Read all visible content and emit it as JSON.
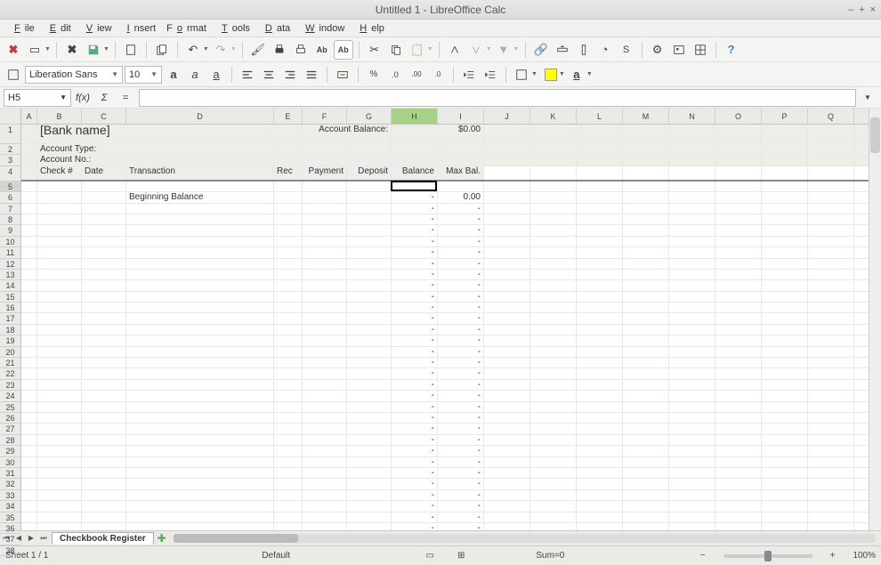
{
  "window": {
    "title": "Untitled 1 - LibreOffice Calc",
    "min": "–",
    "max": "+",
    "close": "×"
  },
  "menus": [
    "File",
    "Edit",
    "View",
    "Insert",
    "Format",
    "Tools",
    "Data",
    "Window",
    "Help"
  ],
  "formatbar": {
    "font": "Liberation Sans",
    "size": "10"
  },
  "namebox": "H5",
  "fx_label": "f(x)",
  "sum_sym": "Σ",
  "eq_sym": "=",
  "columns": [
    "A",
    "B",
    "C",
    "D",
    "E",
    "F",
    "G",
    "H",
    "I",
    "J",
    "K",
    "L",
    "M",
    "N",
    "O",
    "P",
    "Q"
  ],
  "active_col": "H",
  "active_row": 5,
  "template": {
    "bank_name": "[Bank name]",
    "account_balance_label": "Account Balance:",
    "account_balance_value": "$0.00",
    "account_type_label": "Account Type:",
    "account_no_label": "Account No.:",
    "headers": {
      "check": "Check #",
      "date": "Date",
      "transaction": "Transaction",
      "rec": "Rec",
      "payment": "Payment",
      "deposit": "Deposit",
      "balance": "Balance",
      "maxbal": "Max Bal."
    },
    "beginning_balance": "Beginning Balance",
    "zero_val": "0.00",
    "dash": "-"
  },
  "row_count": 38,
  "tabs": {
    "sheet1": "Checkbook Register"
  },
  "status": {
    "sheet": "Sheet 1 / 1",
    "style": "Default",
    "sum": "Sum=0",
    "zoom_minus": "−",
    "zoom_plus": "+",
    "zoom": "100%"
  }
}
